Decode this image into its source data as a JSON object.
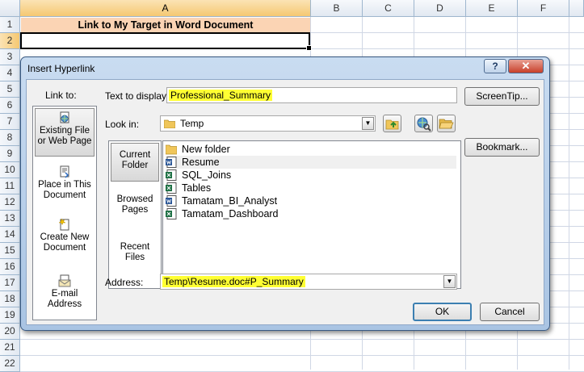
{
  "sheet": {
    "columns": [
      "A",
      "B",
      "C",
      "D",
      "E",
      "F"
    ],
    "rows": [
      "1",
      "2",
      "3",
      "4",
      "5",
      "6",
      "7",
      "8",
      "9",
      "10",
      "11",
      "12",
      "13",
      "14",
      "15",
      "16",
      "17",
      "18",
      "19",
      "20",
      "21",
      "22"
    ],
    "cell_a1": "Link to My Target in Word Document"
  },
  "dialog": {
    "title": "Insert Hyperlink",
    "help_label": "?",
    "close_label": "✕",
    "link_to_label": "Link to:",
    "link_to_items": [
      "Existing File or Web Page",
      "Place in This Document",
      "Create New Document",
      "E-mail Address"
    ],
    "text_to_display_label": "Text to display:",
    "text_to_display_value": "Professional_Summary",
    "screentip_label": "ScreenTip...",
    "look_in_label": "Look in:",
    "look_in_value": "Temp",
    "bookmark_label": "Bookmark...",
    "nav_items": [
      "Current Folder",
      "Browsed Pages",
      "Recent Files"
    ],
    "files": [
      {
        "name": "New folder",
        "icon": "folder-icon"
      },
      {
        "name": "Resume",
        "icon": "word-doc-icon"
      },
      {
        "name": "SQL_Joins",
        "icon": "excel-doc-icon"
      },
      {
        "name": "Tables",
        "icon": "excel-doc-icon"
      },
      {
        "name": "Tamatam_BI_Analyst",
        "icon": "word-doc-icon"
      },
      {
        "name": "Tamatam_Dashboard",
        "icon": "excel-doc-icon"
      }
    ],
    "address_label": "Address:",
    "address_value": "Temp\\Resume.doc#P_Summary",
    "ok_label": "OK",
    "cancel_label": "Cancel"
  }
}
